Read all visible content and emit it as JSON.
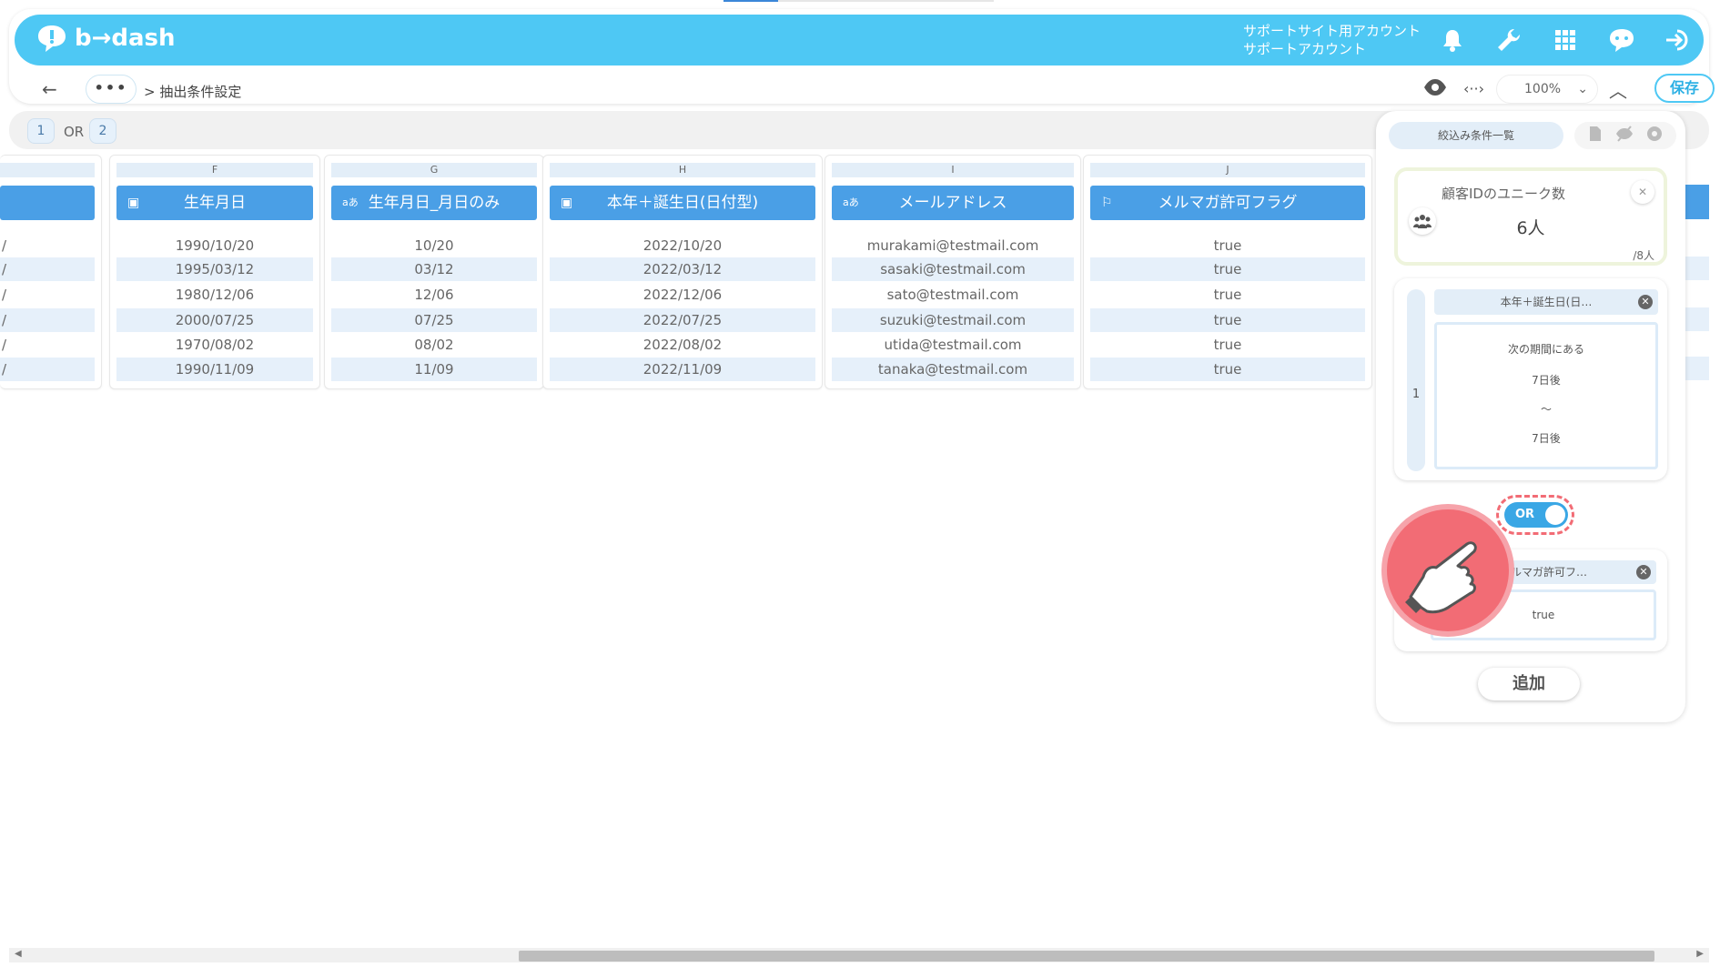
{
  "brand": {
    "logo_text": "b→dash",
    "accent": "#4ec8f4",
    "header_blue": "#4a9fe6",
    "alert_red": "#f26c75"
  },
  "header": {
    "account_line1": "サポートサイト用アカウント",
    "account_line2": "サポートアカウント",
    "icons": [
      "bell-icon",
      "wrench-icon",
      "grid-icon",
      "chat-icon",
      "logout-icon"
    ]
  },
  "subbar": {
    "back_label": "←",
    "more_label": "•••",
    "breadcrumb": "> 抽出条件設定",
    "code_label": "‹··›",
    "zoom": "100%",
    "collapse_label": "︿",
    "save_label": "保存"
  },
  "filter_strip": {
    "chip1": "1",
    "or_label": "OR",
    "chip2": "2"
  },
  "table": {
    "partial_col": {
      "cells": [
        "/",
        "/",
        "/",
        "/",
        "/",
        "/"
      ]
    },
    "columns": [
      {
        "letter": "F",
        "header": "生年月日",
        "icon": "calendar-icon",
        "cells": [
          "1990/10/20",
          "1995/03/12",
          "1980/12/06",
          "2000/07/25",
          "1970/08/02",
          "1990/11/09"
        ]
      },
      {
        "letter": "G",
        "header": "生年月日_月日のみ",
        "icon": "text-type-icon",
        "cells": [
          "10/20",
          "03/12",
          "12/06",
          "07/25",
          "08/02",
          "11/09"
        ]
      },
      {
        "letter": "H",
        "header": "本年＋誕生日(日付型)",
        "icon": "calendar-icon",
        "cells": [
          "2022/10/20",
          "2022/03/12",
          "2022/12/06",
          "2022/07/25",
          "2022/08/02",
          "2022/11/09"
        ]
      },
      {
        "letter": "I",
        "header": "メールアドレス",
        "icon": "text-type-icon",
        "cells": [
          "murakami@testmail.com",
          "sasaki@testmail.com",
          "sato@testmail.com",
          "suzuki@testmail.com",
          "utida@testmail.com",
          "tanaka@testmail.com"
        ]
      },
      {
        "letter": "J",
        "header": "メルマガ許可フラグ",
        "icon": "flag-type-icon",
        "cells": [
          "true",
          "true",
          "true",
          "true",
          "true",
          "true"
        ]
      }
    ]
  },
  "panel": {
    "tab_label": "絞込み条件一覧",
    "count_title": "顧客IDのユニーク数",
    "count_value": "6人",
    "count_total": "/8人",
    "condition1": {
      "index": "1",
      "field": "本年＋誕生日(日…",
      "lines": [
        "次の期間にある",
        "7日後",
        "〜",
        "7日後"
      ]
    },
    "toggle_label": "OR",
    "condition2": {
      "field": "メルマガ許可フ…",
      "value": "true"
    },
    "add_label": "追加"
  }
}
